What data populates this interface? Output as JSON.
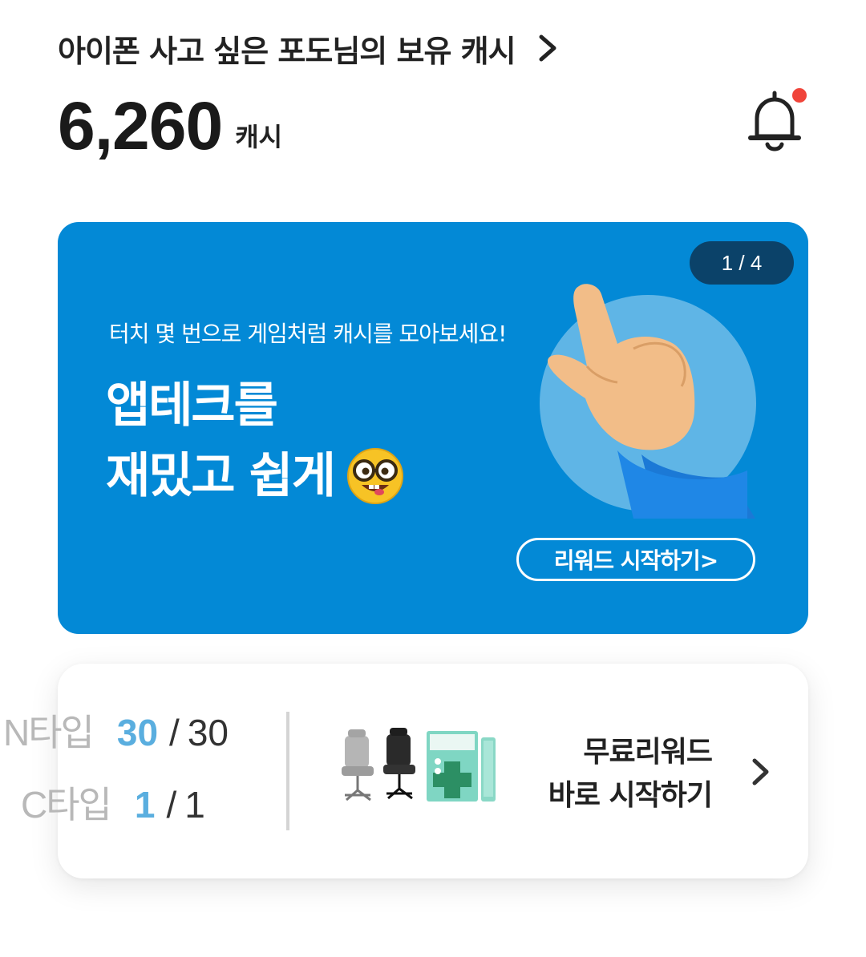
{
  "header": {
    "greeting": "아이폰 사고 싶은 포도님의 보유 캐시",
    "balance_value": "6,260",
    "balance_unit": "캐시"
  },
  "icons": {
    "greeting_arrow": "chevron-right-icon",
    "notification": "bell-icon",
    "notification_badge": "red-dot"
  },
  "banner": {
    "counter": "1 / 4",
    "subtitle": "터치 몇 번으로 게임처럼 캐시를 모아보세요!",
    "title_line1": "앱테크를",
    "title_line2": "재밌고 쉽게",
    "emoji": "nerd-face-emoji",
    "illustration": "pointing-hand",
    "button_label": "리워드 시작하기>",
    "background_color": "#0389d6"
  },
  "reward_card": {
    "n_type_label": "N타입",
    "n_type_current": "30",
    "n_type_total": "30",
    "c_type_label": "C타입",
    "c_type_current": "1",
    "c_type_total": "1",
    "slash": "/",
    "products": [
      "office-chair-gray",
      "office-chair-black",
      "medi-dental-box",
      "medi-dental-stick"
    ],
    "cta_line1": "무료리워드",
    "cta_line2": "바로 시작하기"
  }
}
